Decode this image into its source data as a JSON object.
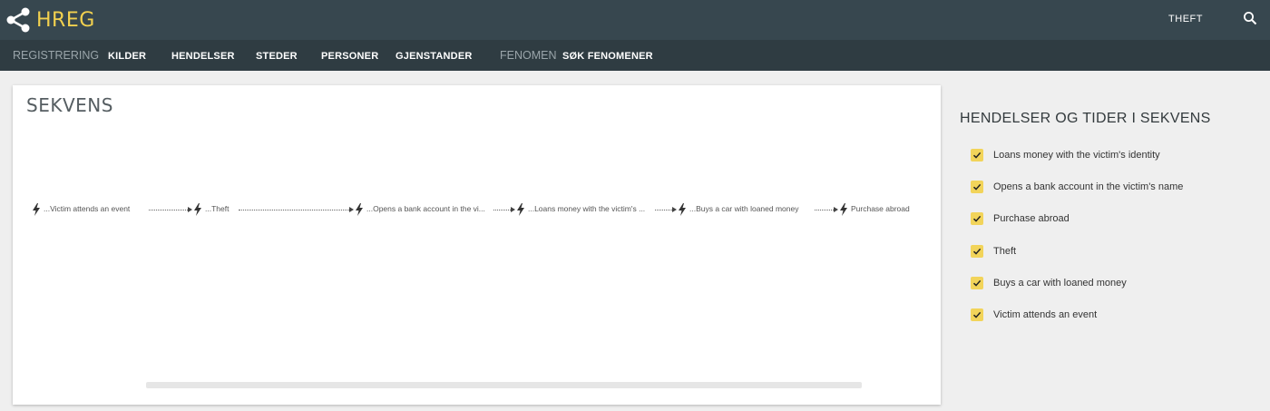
{
  "header": {
    "app_title": "HREG",
    "logo_icon": "share-icon",
    "top_link": "THEFT",
    "search_icon": "search-icon",
    "accent_color": "#f2d14f",
    "bar_color": "#37474f"
  },
  "nav": {
    "group_registrering": "REGISTRERING",
    "items_registrering": [
      "KILDER",
      "HENDELSER",
      "STEDER",
      "PERSONER",
      "GJENSTANDER"
    ],
    "group_fenomen": "FENOMEN",
    "items_fenomen": [
      "SØK FENOMENER"
    ]
  },
  "card": {
    "title": "SEKVENS",
    "timeline": [
      "...Victim attends an event",
      "...Theft",
      "...Opens a bank account in the vi...",
      "...Loans money with the victim's ...",
      "...Buys a car with loaned money",
      "Purchase abroad"
    ]
  },
  "side_panel": {
    "title": "HENDELSER OG TIDER I SEKVENS",
    "check_color": "#f2d45a",
    "events": [
      {
        "label": "Loans money with the victim's identity",
        "checked": true
      },
      {
        "label": "Opens a bank account in the victim's name",
        "checked": true
      },
      {
        "label": "Purchase abroad",
        "checked": true
      },
      {
        "label": "Theft",
        "checked": true
      },
      {
        "label": "Buys a car with loaned money",
        "checked": true
      },
      {
        "label": "Victim attends an event",
        "checked": true
      }
    ]
  }
}
